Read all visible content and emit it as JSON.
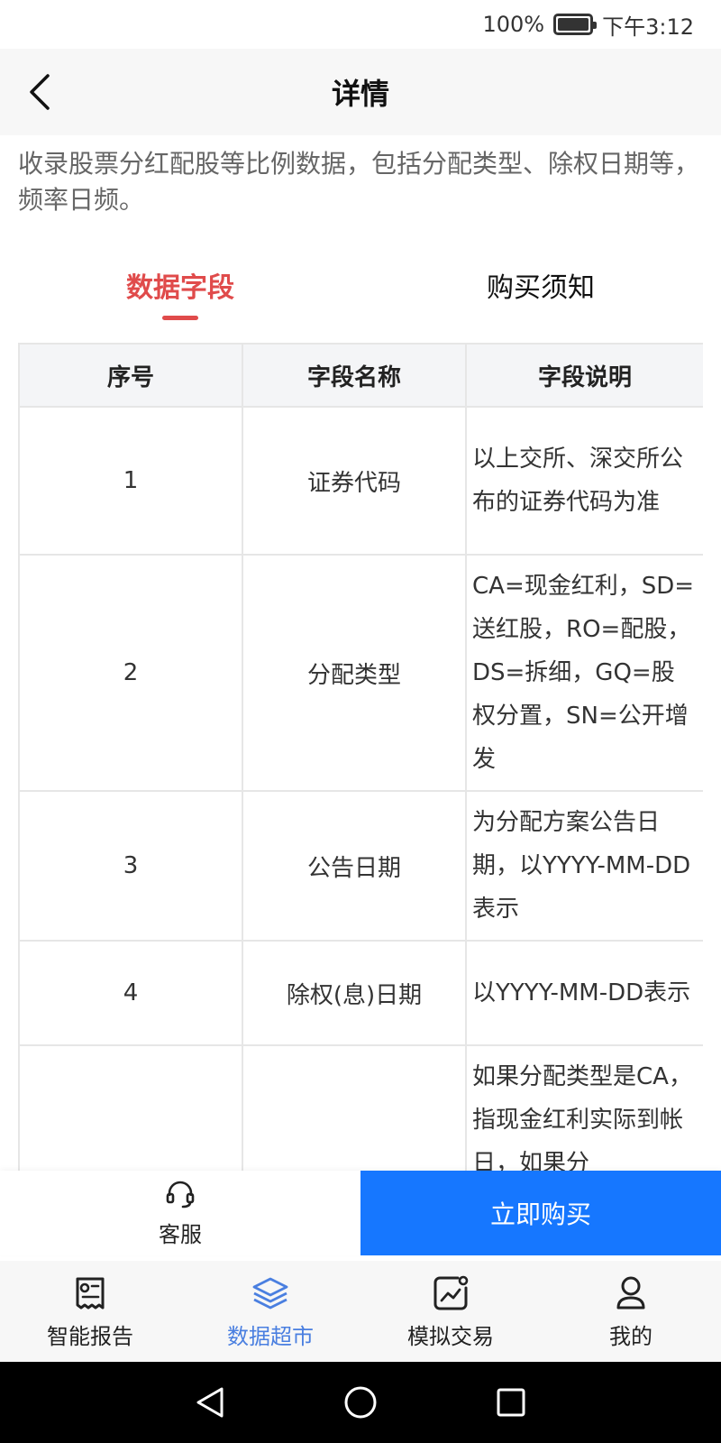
{
  "status_bar": {
    "battery": "100%",
    "time": "下午3:12",
    "battery_level": 1.0
  },
  "header": {
    "title": "详情"
  },
  "intro": "收录股票分红配股等比例数据，包括分配类型、除权日期等，频率日频。",
  "tabs": [
    {
      "label": "数据字段",
      "active": true
    },
    {
      "label": "购买须知",
      "active": false
    }
  ],
  "table": {
    "headers": [
      "序号",
      "字段名称",
      "字段说明"
    ],
    "rows": [
      {
        "index": "1",
        "name": "证券代码",
        "desc": "以上交所、深交所公布的证券代码为准"
      },
      {
        "index": "2",
        "name": "分配类型",
        "desc": "CA=现金红利，SD=送红股，RO=配股，DS=拆细，GQ=股权分置，SN=公开增发"
      },
      {
        "index": "3",
        "name": "公告日期",
        "desc": "为分配方案公告日期，以YYYY-MM-DD表示"
      },
      {
        "index": "4",
        "name": "除权(息)日期",
        "desc": "以YYYY-MM-DD表示"
      },
      {
        "index": "",
        "name": "",
        "desc": "如果分配类型是CA，指现金红利实际到帐日，如果分"
      }
    ]
  },
  "action_bar": {
    "service_label": "客服",
    "buy_label": "立即购买"
  },
  "bottom_nav": [
    {
      "label": "智能报告",
      "icon": "report-icon",
      "active": false
    },
    {
      "label": "数据超市",
      "icon": "layers-icon",
      "active": true
    },
    {
      "label": "模拟交易",
      "icon": "chart-trade-icon",
      "active": false
    },
    {
      "label": "我的",
      "icon": "user-icon",
      "active": false
    }
  ],
  "colors": {
    "accent_red": "#e04b4b",
    "primary_blue": "#1677ff",
    "nav_active": "#4a7fe0"
  }
}
